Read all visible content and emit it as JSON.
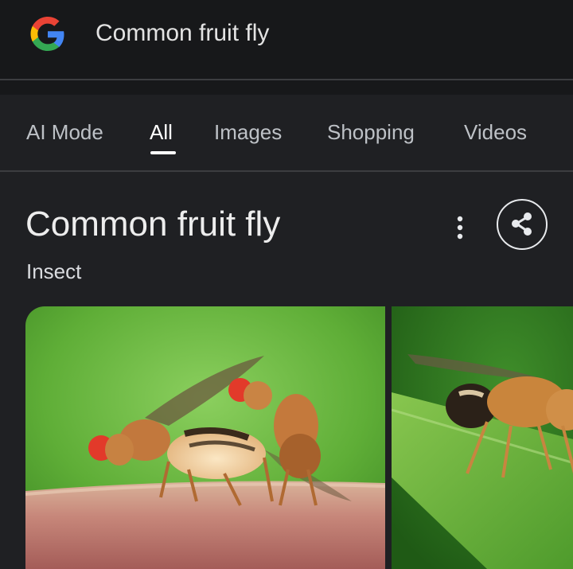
{
  "search": {
    "query": "Common fruit fly"
  },
  "tabs": [
    {
      "label": "AI Mode"
    },
    {
      "label": "All"
    },
    {
      "label": "Images"
    },
    {
      "label": "Shopping"
    },
    {
      "label": "Videos"
    }
  ],
  "active_tab": "All",
  "entity": {
    "title": "Common fruit fly",
    "subtitle": "Insect"
  },
  "icons": {
    "logo": "google-g-logo",
    "more": "more-vert-icon",
    "share": "share-icon"
  },
  "colors": {
    "background": "#1f2023",
    "header_background": "#17181a",
    "google_blue": "#4285f4",
    "google_red": "#ea4335",
    "google_yellow": "#fbbc05",
    "google_green": "#34a853"
  },
  "images": [
    {
      "subject": "fruit-fly-pair-photo"
    },
    {
      "subject": "fruit-fly-on-leaf-photo"
    }
  ]
}
